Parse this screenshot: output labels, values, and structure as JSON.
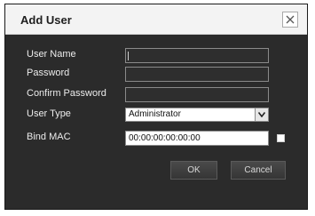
{
  "dialog": {
    "title": "Add User",
    "close_glyph": "×"
  },
  "form": {
    "username_label": "User Name",
    "username_value": "",
    "password_label": "Password",
    "password_value": "",
    "confirm_label": "Confirm Password",
    "confirm_value": "",
    "usertype_label": "User Type",
    "usertype_value": "Administrator",
    "bindmac_label": "Bind MAC",
    "mac_value": "00:00:00:00:00:00",
    "bindmac_checked": false
  },
  "buttons": {
    "ok": "OK",
    "cancel": "Cancel"
  },
  "colors": {
    "dialog_bg": "#2b2b2b",
    "titlebar_bg": "#f3f3f3",
    "label_text": "#ececec"
  },
  "icons": {
    "close": "close-icon",
    "dropdown": "chevron-down-icon"
  }
}
